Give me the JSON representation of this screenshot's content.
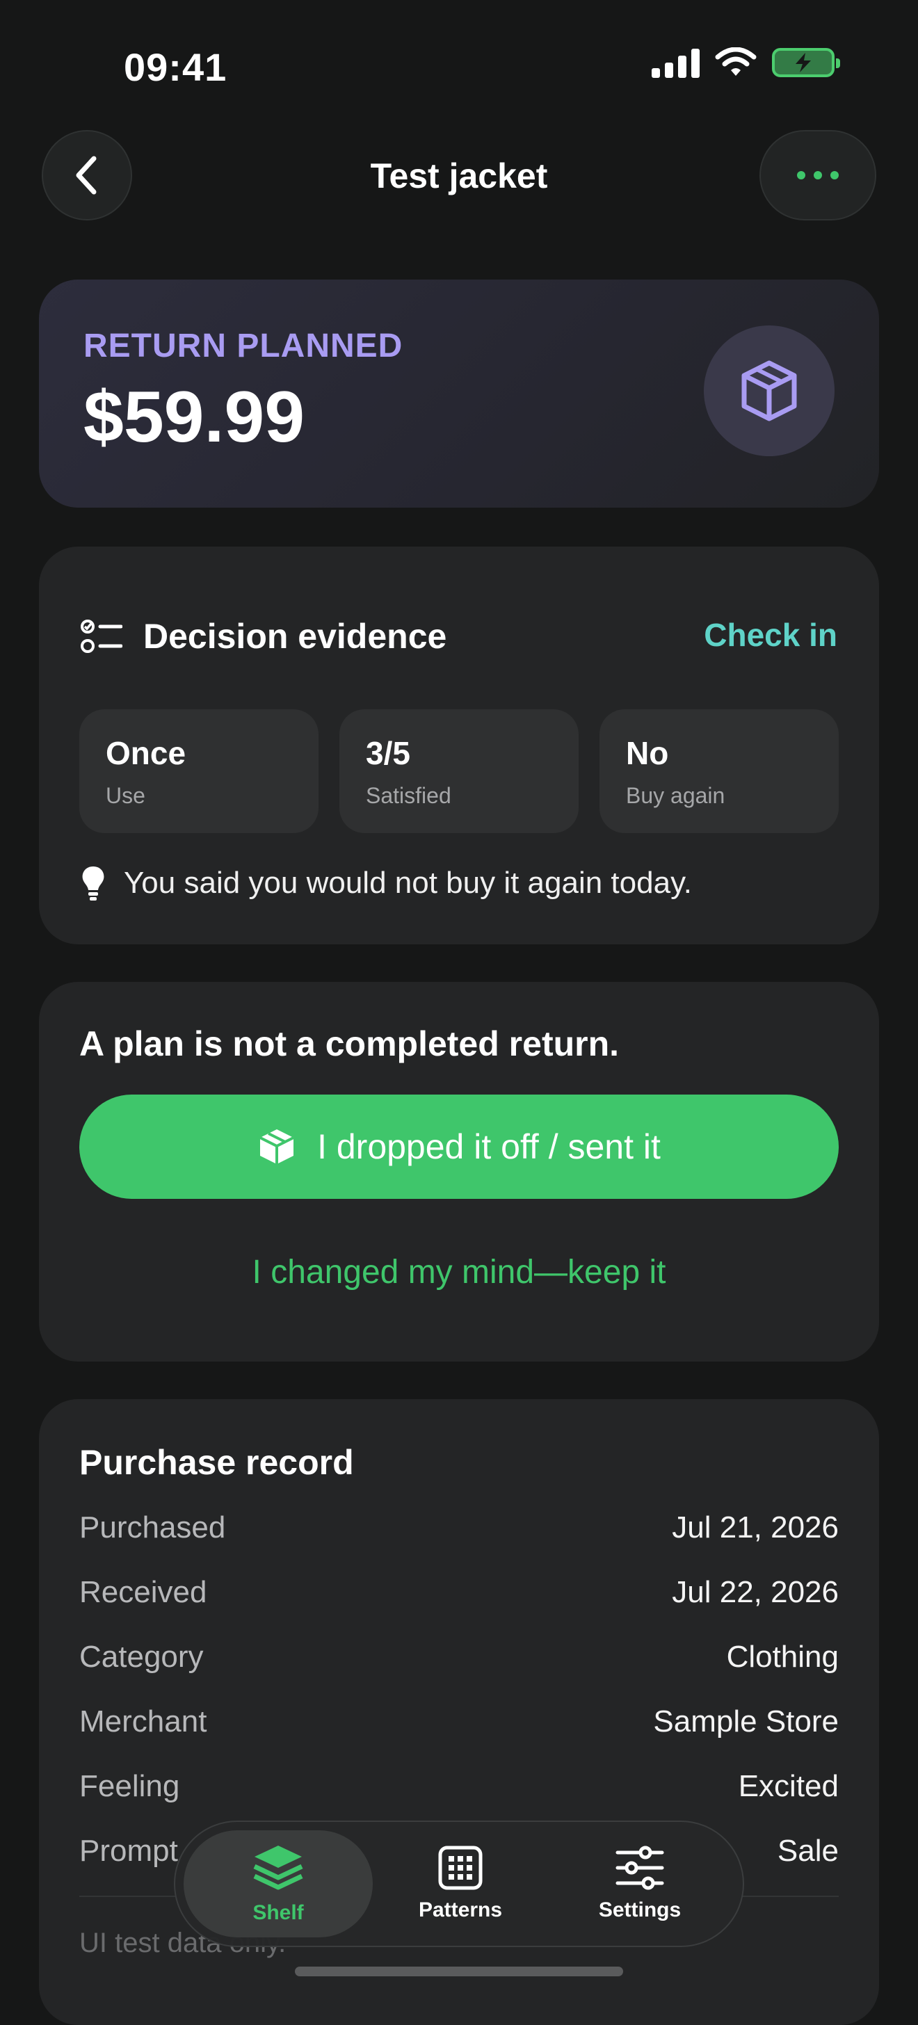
{
  "status_bar": {
    "time": "09:41"
  },
  "nav": {
    "title": "Test jacket"
  },
  "return_card": {
    "label": "RETURN PLANNED",
    "price": "$59.99",
    "icon": "box-icon"
  },
  "evidence": {
    "title": "Decision evidence",
    "action": "Check in",
    "stats": [
      {
        "value": "Once",
        "label": "Use"
      },
      {
        "value": "3/5",
        "label": "Satisfied"
      },
      {
        "value": "No",
        "label": "Buy again"
      }
    ],
    "note": "You said you would not buy it again today."
  },
  "plan": {
    "title": "A plan is not a completed return.",
    "primary_label": "I dropped it off / sent it",
    "secondary_label": "I changed my mind—keep it"
  },
  "record": {
    "title": "Purchase record",
    "rows": [
      {
        "key": "Purchased",
        "value": "Jul 21, 2026"
      },
      {
        "key": "Received",
        "value": "Jul 22, 2026"
      },
      {
        "key": "Category",
        "value": "Clothing"
      },
      {
        "key": "Merchant",
        "value": "Sample Store"
      },
      {
        "key": "Feeling",
        "value": "Excited"
      },
      {
        "key": "Prompt",
        "value": "Sale"
      }
    ],
    "footer": "UI test data only."
  },
  "tabs": [
    {
      "label": "Shelf",
      "icon": "layers-icon",
      "active": true
    },
    {
      "label": "Patterns",
      "icon": "grid-icon",
      "active": false
    },
    {
      "label": "Settings",
      "icon": "sliders-icon",
      "active": false
    }
  ],
  "colors": {
    "accent": "#3fc66b",
    "purple": "#a99cf2",
    "teal": "#5fd3c8",
    "background": "#161717"
  }
}
